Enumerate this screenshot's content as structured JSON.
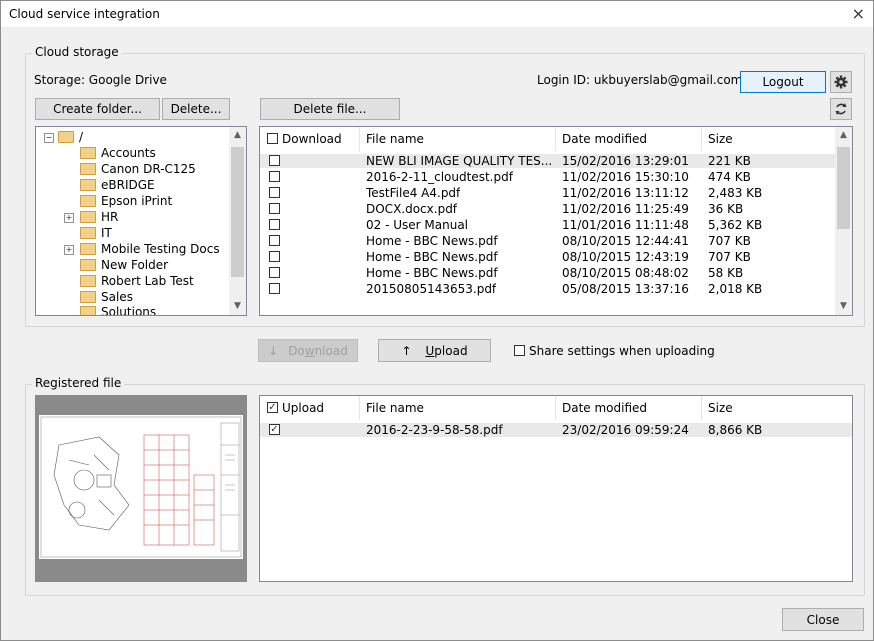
{
  "window": {
    "title": "Cloud service integration",
    "close_glyph": "×"
  },
  "cloud_storage": {
    "group_label": "Cloud storage",
    "storage_text": "Storage: Google Drive",
    "login_text": "Login ID: ukbuyerslab@gmail.com",
    "logout_label": "Logout",
    "settings_icon": "gear-icon",
    "refresh_icon": "refresh-icon",
    "create_folder_label": "Create folder...",
    "delete_label": "Delete...",
    "delete_file_label": "Delete file...",
    "tree_root": "/",
    "folders": [
      "Accounts",
      "Canon DR-C125",
      "eBRIDGE",
      "Epson iPrint",
      "HR",
      "IT",
      "Mobile Testing Docs",
      "New Folder",
      "Robert Lab Test",
      "Sales",
      "Solutions"
    ],
    "columns": {
      "download": "Download",
      "file_name": "File name",
      "date_modified": "Date modified",
      "size": "Size"
    },
    "files": [
      {
        "name": "NEW BLI IMAGE QUALITY TES...",
        "date": "15/02/2016 13:29:01",
        "size": "221 KB"
      },
      {
        "name": "2016-2-11_cloudtest.pdf",
        "date": "11/02/2016 15:30:10",
        "size": "474 KB"
      },
      {
        "name": "TestFile4 A4.pdf",
        "date": "11/02/2016 13:11:12",
        "size": "2,483 KB"
      },
      {
        "name": "DOCX.docx.pdf",
        "date": "11/02/2016 11:25:49",
        "size": "36 KB"
      },
      {
        "name": "02 - User Manual",
        "date": "11/01/2016 11:11:48",
        "size": "5,362 KB"
      },
      {
        "name": "Home - BBC News.pdf",
        "date": "08/10/2015 12:44:41",
        "size": "707 KB"
      },
      {
        "name": "Home - BBC News.pdf",
        "date": "08/10/2015 12:43:19",
        "size": "707 KB"
      },
      {
        "name": "Home - BBC News.pdf",
        "date": "08/10/2015 08:48:02",
        "size": "58 KB"
      },
      {
        "name": "20150805143653.pdf",
        "date": "05/08/2015 13:37:16",
        "size": "2,018 KB"
      }
    ]
  },
  "transfer": {
    "download_arrow": "↓",
    "download_pre": "Do",
    "download_key": "w",
    "download_post": "nload",
    "upload_arrow": "↑",
    "upload_key": "U",
    "upload_post": "pload",
    "share_label": "Share settings when uploading"
  },
  "registered": {
    "group_label": "Registered file",
    "columns": {
      "upload": "Upload",
      "file_name": "File name",
      "date_modified": "Date modified",
      "size": "Size"
    },
    "files": [
      {
        "name": "2016-2-23-9-58-58.pdf",
        "date": "23/02/2016 09:59:24",
        "size": "8,866 KB",
        "checked": true
      }
    ],
    "check_glyph": "✓"
  },
  "footer": {
    "close_label": "Close"
  }
}
